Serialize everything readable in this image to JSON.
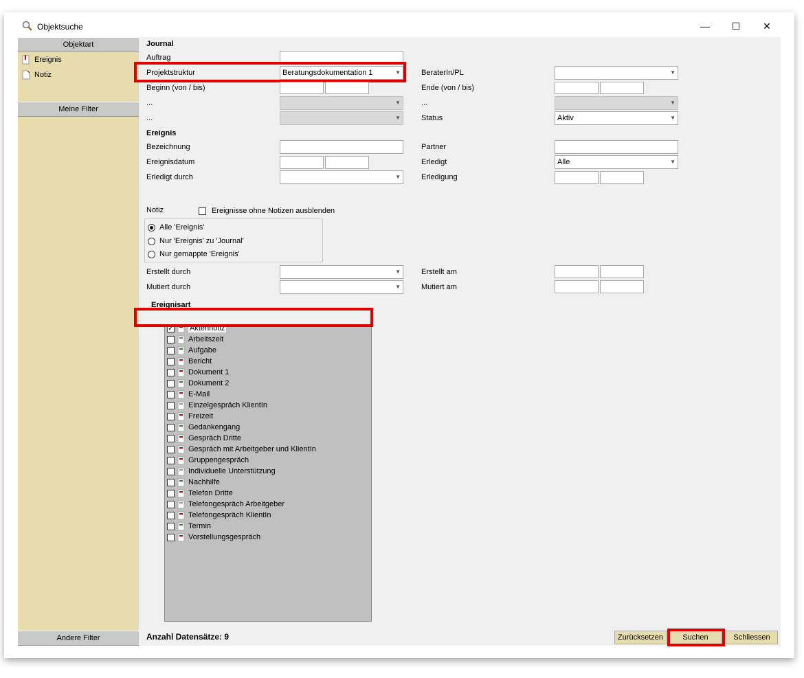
{
  "window": {
    "title": "Objektsuche",
    "minimize": "—",
    "maximize": "☐",
    "close": "✕"
  },
  "sidebar": {
    "header1": "Objektart",
    "items": [
      {
        "label": "Ereignis"
      },
      {
        "label": "Notiz"
      }
    ],
    "header2": "Meine Filter",
    "header3": "Andere Filter"
  },
  "journal": {
    "title": "Journal",
    "auftrag": "Auftrag",
    "projektstruktur": "Projektstruktur",
    "projektstruktur_value": "Beratungsdokumentation 1",
    "beginn": "Beginn (von / bis)",
    "dots1": "...",
    "dots2": "...",
    "berater": "BeraterIn/PL",
    "ende": "Ende (von / bis)",
    "dots3": "...",
    "status": "Status",
    "status_value": "Aktiv"
  },
  "ereignis": {
    "title": "Ereignis",
    "bezeichnung": "Bezeichnung",
    "ereignisdatum": "Ereignisdatum",
    "erledigt_durch": "Erledigt durch",
    "partner": "Partner",
    "erledigt": "Erledigt",
    "erledigt_value": "Alle",
    "erledigung": "Erledigung"
  },
  "notiz": {
    "label": "Notiz",
    "hide_label": "Ereignisse ohne Notizen ausblenden",
    "radios": [
      "Alle 'Ereignis'",
      "Nur 'Ereignis' zu 'Journal'",
      "Nur gemappte 'Ereignis'"
    ],
    "erstellt_durch": "Erstellt durch",
    "mutiert_durch": "Mutiert durch",
    "erstellt_am": "Erstellt am",
    "mutiert_am": "Mutiert am"
  },
  "ereignisart": {
    "title": "Ereignisart",
    "items": [
      {
        "label": "Aktennotiz",
        "checked": true
      },
      {
        "label": "Arbeitszeit",
        "checked": false
      },
      {
        "label": "Aufgabe",
        "checked": false
      },
      {
        "label": "Bericht",
        "checked": false
      },
      {
        "label": "Dokument 1",
        "checked": false
      },
      {
        "label": "Dokument 2",
        "checked": false
      },
      {
        "label": "E-Mail",
        "checked": false
      },
      {
        "label": "Einzelgespräch KlientIn",
        "checked": false
      },
      {
        "label": "Freizeit",
        "checked": false
      },
      {
        "label": "Gedankengang",
        "checked": false
      },
      {
        "label": "Gespräch Dritte",
        "checked": false
      },
      {
        "label": "Gespräch mit Arbeitgeber und KlientIn",
        "checked": false
      },
      {
        "label": "Gruppengespräch",
        "checked": false
      },
      {
        "label": "Individuelle Unterstützung",
        "checked": false
      },
      {
        "label": "Nachhilfe",
        "checked": false
      },
      {
        "label": "Telefon Dritte",
        "checked": false
      },
      {
        "label": "Telefongespräch Arbeitgeber",
        "checked": false
      },
      {
        "label": "Telefongespräch KlientIn",
        "checked": false
      },
      {
        "label": "Termin",
        "checked": false
      },
      {
        "label": "Vorstellungsgespräch",
        "checked": false
      }
    ]
  },
  "footer": {
    "count": "Anzahl Datensätze: 9",
    "reset": "Zurücksetzen",
    "search": "Suchen",
    "close": "Schliessen"
  }
}
